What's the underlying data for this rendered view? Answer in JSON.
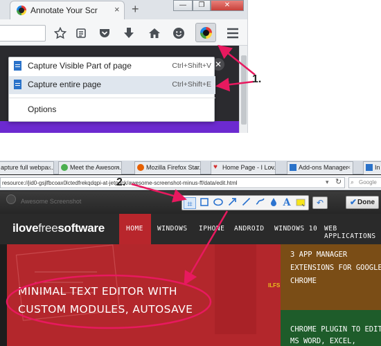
{
  "top": {
    "tab_title": "Annotate Your Scr",
    "tab_close": "×",
    "new_tab": "+",
    "window_buttons": [
      "—",
      "❐",
      "✕"
    ],
    "menu_items": [
      {
        "label": "Capture Visible Part of page",
        "shortcut": "Ctrl+Shift+V"
      },
      {
        "label": "Capture entire page",
        "shortcut": "Ctrl+Shift+E"
      }
    ],
    "options_label": "Options"
  },
  "bottom": {
    "tabs": [
      {
        "label": "apture full webpa...",
        "color": "#2a72c9"
      },
      {
        "label": "Meet the Awesom...",
        "color": "#4caf50"
      },
      {
        "label": "Mozilla Firefox Star...",
        "color": "#e66000"
      },
      {
        "label": "Home Page - I Lov...",
        "color": "#d32f2f"
      },
      {
        "label": "Add-ons Manager",
        "color": "#2a72c9"
      },
      {
        "label": "In",
        "color": "#2a72c9"
      }
    ],
    "url": "resource://jid0-gsjlfbcoax0lctedfrekqdqpi-at-jetpack/awesome-screenshot-minus-ff/data/edit.html",
    "search_placeholder": "Google",
    "editor_title": "Awesome Screenshot",
    "done_label": "Done",
    "site_logo": {
      "part1": "ilove",
      "part2": "free",
      "part3": "software"
    },
    "nav": [
      "HOME",
      "WINDOWS",
      "IPHONE",
      "ANDROID",
      "WINDOWS 10",
      "WEB APPLICATIONS"
    ],
    "hero_title": "MINIMAL TEXT EDITOR WITH CUSTOM MODULES, AUTOSAVE",
    "watermark": "ILFS",
    "side_story_1": "3 APP MANAGER EXTENSIONS FOR GOOGLE CHROME",
    "side_story_2": "CHROME PLUGIN TO EDIT MS WORD, EXCEL, POWERPOINT"
  },
  "annotations": {
    "label_1": "1.",
    "label_2": "2.",
    "accent_color": "#e8195f"
  }
}
